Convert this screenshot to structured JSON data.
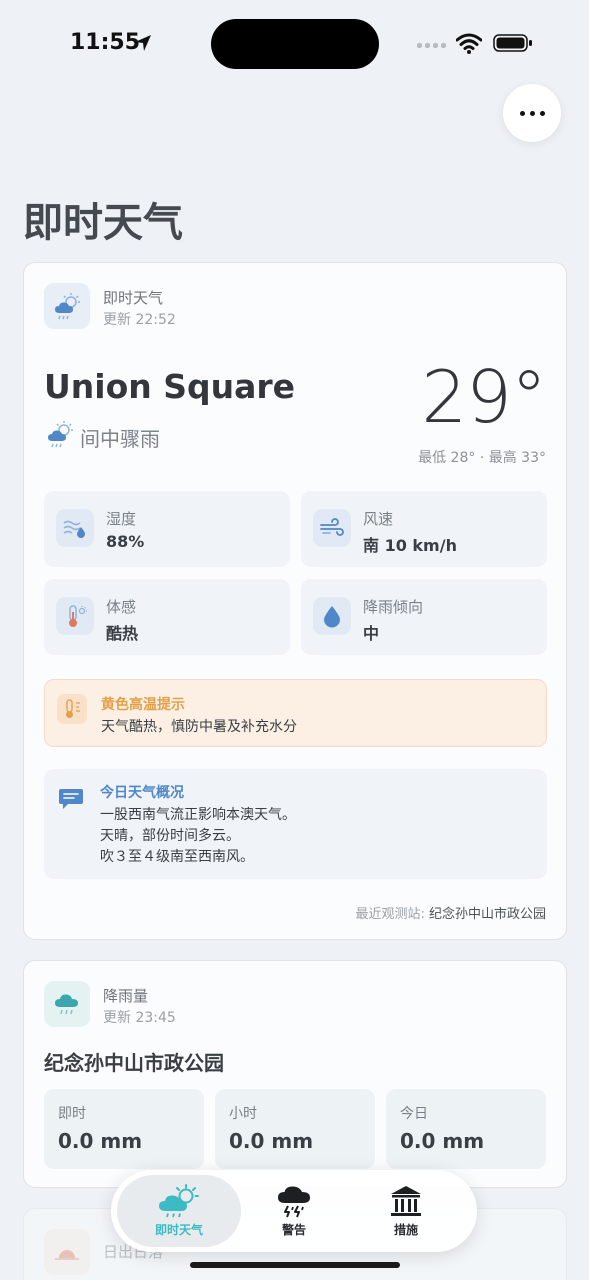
{
  "status_bar": {
    "time": "11:55"
  },
  "page": {
    "title": "即时天气"
  },
  "current": {
    "card_label": "即时天气",
    "updated": "更新 22:52",
    "location": "Union Square",
    "condition": "间中骤雨",
    "temperature": "29°",
    "range": "最低 28° · 最高 33°",
    "tiles": [
      {
        "label": "湿度",
        "value": "88%"
      },
      {
        "label": "风速",
        "value": "南 10 km/h"
      },
      {
        "label": "体感",
        "value": "酷热"
      },
      {
        "label": "降雨倾向",
        "value": "中"
      }
    ],
    "alert": {
      "title": "黄色高温提示",
      "text": "天气酷热，慎防中暑及补充水分"
    },
    "summary": {
      "title": "今日天气概况",
      "lines": [
        "一股西南气流正影响本澳天气。",
        "天晴，部份时间多云。",
        "吹３至４级南至西南风。"
      ]
    },
    "station_label": "最近观测站:",
    "station_name": "纪念孙中山市政公园"
  },
  "rainfall": {
    "card_label": "降雨量",
    "updated": "更新 23:45",
    "station": "纪念孙中山市政公园",
    "tiles": [
      {
        "label": "即时",
        "value": "0.0 mm"
      },
      {
        "label": "小时",
        "value": "0.0 mm"
      },
      {
        "label": "今日",
        "value": "0.0 mm"
      }
    ]
  },
  "sun": {
    "card_label": "日出日落"
  },
  "tabbar": {
    "tabs": [
      {
        "label": "即时天气",
        "icon": "weather-icon",
        "active": true
      },
      {
        "label": "警告",
        "icon": "storm-icon",
        "active": false
      },
      {
        "label": "措施",
        "icon": "building-icon",
        "active": false
      }
    ]
  },
  "colors": {
    "accent": "#3bbbc4",
    "alert_title": "#e3a04a",
    "summary_title": "#4f87c9"
  }
}
